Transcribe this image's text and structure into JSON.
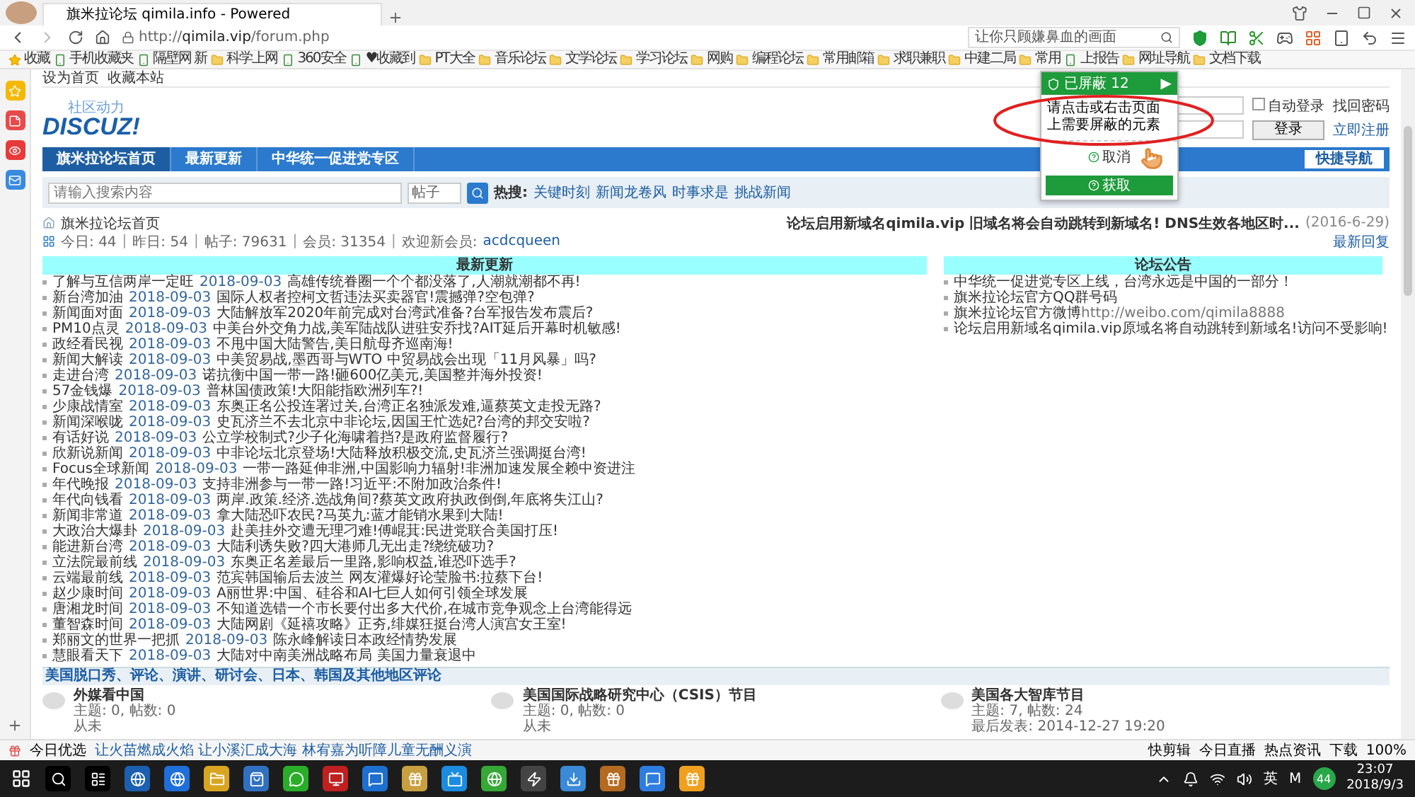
{
  "browser": {
    "tab_title": "旗米拉论坛 qimila.info - Powered",
    "url_scheme": "http://",
    "url_host": "qimila.vip",
    "url_path": "/forum.php",
    "search_value": "让你只顾嫌鼻血的画面"
  },
  "bookmarks": [
    {
      "label": "收藏",
      "kind": "menu"
    },
    {
      "label": "手机收藏夹",
      "kind": "link"
    },
    {
      "label": "隔壁网 新",
      "kind": "link"
    },
    {
      "label": "科学上网",
      "kind": "folder"
    },
    {
      "label": "360安全",
      "kind": "link"
    },
    {
      "label": "♥收藏到",
      "kind": "link"
    },
    {
      "label": "PT大全",
      "kind": "folder"
    },
    {
      "label": "音乐论坛",
      "kind": "folder"
    },
    {
      "label": "文学论坛",
      "kind": "folder"
    },
    {
      "label": "学习论坛",
      "kind": "folder"
    },
    {
      "label": "网购",
      "kind": "folder"
    },
    {
      "label": "编程论坛",
      "kind": "folder"
    },
    {
      "label": "常用邮箱",
      "kind": "folder"
    },
    {
      "label": "求职兼职",
      "kind": "folder"
    },
    {
      "label": "中建二局",
      "kind": "folder"
    },
    {
      "label": "常用",
      "kind": "folder"
    },
    {
      "label": "上报告",
      "kind": "link"
    },
    {
      "label": "网址导航",
      "kind": "folder"
    },
    {
      "label": "文档下载",
      "kind": "folder"
    }
  ],
  "forum": {
    "top_links": [
      "设为首页",
      "收藏本站"
    ],
    "logo_tagline": "社区动力",
    "logo_text": "DISCUZ!",
    "login": {
      "autologin": "自动登录",
      "autologin_checked": false,
      "find_password": "找回密码",
      "login_button": "登录",
      "register": "立即注册"
    },
    "nav": [
      {
        "label": "旗米拉论坛首页",
        "selected": true
      },
      {
        "label": "最新更新",
        "selected": false
      },
      {
        "label": "中华统一促进党专区",
        "selected": false
      }
    ],
    "quick_nav": "快捷导航",
    "search": {
      "placeholder": "请输入搜索内容",
      "scope": "帖子",
      "hot_label": "热搜:",
      "hot": [
        "关键时刻",
        "新闻龙卷风",
        "时事求是",
        "挑战新闻"
      ]
    },
    "breadcrumb": "旗米拉论坛首页",
    "notice": {
      "text": "论坛启用新域名qimila.vip 旧域名将会自动跳转到新域名! DNS生效各地区时...",
      "date": "(2016-6-29)"
    },
    "stats": [
      {
        "label": "今日:",
        "value": "44"
      },
      {
        "label": "昨日:",
        "value": "54"
      },
      {
        "label": "帖子:",
        "value": "79631"
      },
      {
        "label": "会员:",
        "value": "31354"
      }
    ],
    "stats_separator": "|",
    "newest_member_label": "欢迎新会员:",
    "newest_member": "acdcqueen",
    "latest_reply": "最新回复",
    "latest": {
      "title": "最新更新",
      "items": [
        {
          "source": "了解与互信两岸一定旺",
          "date": "2018-09-03",
          "title": "高雄传统眷圈一个个都没落了,人潮就潮都不再!"
        },
        {
          "source": "新台湾加油",
          "date": "2018-09-03",
          "title": "国际人权者控柯文哲违法买卖器官!震撼弹?空包弹?"
        },
        {
          "source": "新闻面对面",
          "date": "2018-09-03",
          "title": "大陆解放军2020年前完成对台湾武准备?台军报告发布震后?"
        },
        {
          "source": "PM10点灵",
          "date": "2018-09-03",
          "title": "中美台外交角力战,美军陆战队进驻安乔找?AIT延后开幕时机敏感!"
        },
        {
          "source": "政经看民视",
          "date": "2018-09-03",
          "title": "不甩中国大陆警告,美日航母齐巡南海!"
        },
        {
          "source": "新闻大解读",
          "date": "2018-09-03",
          "title": "中美贸易战,墨西哥与WTO 中贸易战会出现「11月风暴」吗?"
        },
        {
          "source": "走进台湾",
          "date": "2018-09-03",
          "title": "诺抗衡中国一带一路!砸600亿美元,美国整并海外投资!"
        },
        {
          "source": "57金钱爆",
          "date": "2018-09-03",
          "title": "普林国债政策!大阳能指欧洲列车?!"
        },
        {
          "source": "少康战情室",
          "date": "2018-09-03",
          "title": "东奥正名公投连署过关,台湾正名独派发难,逼蔡英文走投无路?"
        },
        {
          "source": "新闻深喉咙",
          "date": "2018-09-03",
          "title": "史瓦济兰不去北京中非论坛,因国王忙选妃?台湾的邦交安啦?"
        },
        {
          "source": "有话好说",
          "date": "2018-09-03",
          "title": "公立学校制式?少子化海啸着挡?是政府监督履行?"
        },
        {
          "source": "欣新说新闻",
          "date": "2018-09-03",
          "title": "中非论坛北京登场!大陆释放积极交流,史瓦济兰强调挺台湾!"
        },
        {
          "source": "Focus全球新闻",
          "date": "2018-09-03",
          "title": "一带一路延伸非洲,中国影响力辐射!非洲加速发展全赖中资进注"
        },
        {
          "source": "年代晚报",
          "date": "2018-09-03",
          "title": "支持非洲参与一带一路!习近平:不附加政治条件!"
        },
        {
          "source": "年代向钱看",
          "date": "2018-09-03",
          "title": "两岸.政策.经济.选战角间?蔡英文政府执政倒倒,年底将失江山?"
        },
        {
          "source": "新闻非常道",
          "date": "2018-09-03",
          "title": "拿大陆恐吓农民?马英九:蓝才能销水果到大陆!"
        },
        {
          "source": "大政治大爆卦",
          "date": "2018-09-03",
          "title": "赴美挂外交遭无理刁难!傅崐萁:民进党联合美国打压!"
        },
        {
          "source": "能进新台湾",
          "date": "2018-09-03",
          "title": "大陆利诱失败?四大港师几无出走?绕统破功?"
        },
        {
          "source": "立法院最前线",
          "date": "2018-09-03",
          "title": "东奥正名差最后一里路,影响权益,谁恐吓选手?"
        },
        {
          "source": "云端最前线",
          "date": "2018-09-03",
          "title": "范宾韩国输后去波兰 网友灌爆好论莹脸书:拉蔡下台!"
        },
        {
          "source": "赵少康时间",
          "date": "2018-09-03",
          "title": "A丽世界:中国、硅谷和AI七巨人如何引领全球发展"
        },
        {
          "source": "唐湘龙时间",
          "date": "2018-09-03",
          "title": "不知道选错一个市长要付出多大代价,在城市竞争观念上台湾能得远"
        },
        {
          "source": "董智森时间",
          "date": "2018-09-03",
          "title": "大陆网剧《延禧攻略》正夯,绯媒狂挺台湾人演宫女王室!"
        },
        {
          "source": "郑丽文的世界一把抓",
          "date": "2018-09-03",
          "title": "陈永峰解读日本政经情势发展"
        },
        {
          "source": "慧眼看天下",
          "date": "2018-09-03",
          "title": "大陆对中南美洲战略布局 美国力量衰退中"
        }
      ]
    },
    "announcements": {
      "title": "论坛公告",
      "items": [
        {
          "text": "中华统一促进党专区上线，台湾永远是中国的一部分！"
        },
        {
          "text": "旗米拉论坛官方QQ群号码"
        },
        {
          "text": "旗米拉论坛官方微博",
          "link": "http://weibo.com/qimila8888"
        },
        {
          "text": "论坛启用新域名qimila.vip原域名将自动跳转到新域名!访问不受影响!"
        }
      ]
    },
    "category": {
      "title": "美国脱口秀、评论、演讲、研讨会、日本、韩国及其他地区评论",
      "forums": [
        {
          "name": "外媒看中国",
          "stats": "主题: 0, 帖数: 0",
          "last": "从未"
        },
        {
          "name": "美国国际战略研究中心（CSIS）节目",
          "stats": "主题: 0, 帖数: 0",
          "last": "从未"
        },
        {
          "name": "美国各大智库节目",
          "stats": "主题: 7, 帖数: 24",
          "last": "最后发表: 2014-12-27 19:20"
        }
      ]
    }
  },
  "popup": {
    "blocked": "已屏蔽 12",
    "arrow": "▶",
    "hint": "请点击或右击页面上需要屏蔽的元素",
    "cancel": "取消",
    "help": "获取"
  },
  "status_bar": {
    "label": "今日优选",
    "headline": "让火苗燃成火焰 让小溪汇成大海 林宥嘉为听障儿童无酬义演",
    "items": [
      "快剪辑",
      "今日直播",
      "热点资讯",
      "下载"
    ],
    "zoom": "100%"
  },
  "taskbar": {
    "ime": "英",
    "m": "M",
    "badge": "44",
    "time": "23:07",
    "date": "2018/9/3"
  }
}
